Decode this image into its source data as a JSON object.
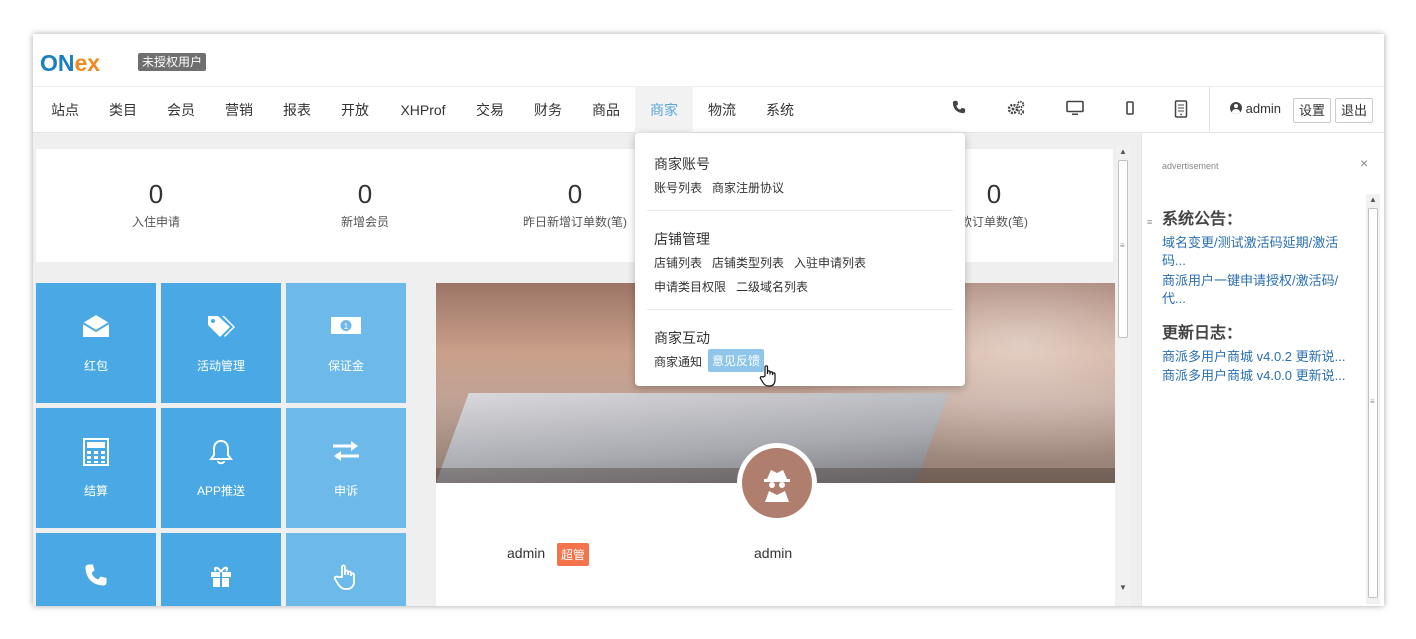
{
  "brand": {
    "logo_on": "ON",
    "logo_ex": "ex",
    "unauth_badge": "未授权用户"
  },
  "nav": {
    "items": [
      "站点",
      "类目",
      "会员",
      "营销",
      "报表",
      "开放",
      "XHProf",
      "交易",
      "财务",
      "商品",
      "商家",
      "物流",
      "系统"
    ],
    "active": "商家",
    "icons": [
      "phone-icon",
      "gears-icon",
      "desktop-icon",
      "mobile-icon",
      "tablet-icon"
    ],
    "admin_name": "admin",
    "settings_label": "设置",
    "logout_label": "退出"
  },
  "stats": [
    {
      "value": "0",
      "label": "入住申请"
    },
    {
      "value": "0",
      "label": "新增会员"
    },
    {
      "value": "0",
      "label": "昨日新增订单数(笔)"
    },
    {
      "value": "0",
      "label": "款订单数(笔)"
    }
  ],
  "tiles": [
    {
      "label": "红包",
      "icon": "envelope-icon"
    },
    {
      "label": "活动管理",
      "icon": "tags-icon"
    },
    {
      "label": "保证金",
      "icon": "money-icon"
    },
    {
      "label": "结算",
      "icon": "calculator-icon"
    },
    {
      "label": "APP推送",
      "icon": "bell-icon"
    },
    {
      "label": "申诉",
      "icon": "exchange-icon"
    },
    {
      "label": "",
      "icon": "phone-icon"
    },
    {
      "label": "",
      "icon": "gift-icon"
    },
    {
      "label": "",
      "icon": "hand-pointer-icon"
    }
  ],
  "profile": {
    "name_left": "admin",
    "super_badge": "超管",
    "name_right": "admin"
  },
  "dropdown": {
    "section1_title": "商家账号",
    "section1_links": [
      "账号列表",
      "商家注册协议"
    ],
    "section2_title": "店铺管理",
    "section2_links_row1": [
      "店铺列表",
      "店铺类型列表",
      "入驻申请列表"
    ],
    "section2_links_row2": [
      "申请类目权限",
      "二级域名列表"
    ],
    "section3_title": "商家互动",
    "section3_links": [
      "商家通知",
      "意见反馈"
    ]
  },
  "right_panel": {
    "ad_label": "advertisement",
    "close": "×",
    "notice_heading": "系统公告：",
    "notice_links": [
      "域名变更/测试激活码延期/激活码...",
      "商派用户一键申请授权/激活码/代..."
    ],
    "changelog_heading": "更新日志：",
    "changelog_links": [
      "商派多用户商城 v4.0.2 更新说...",
      "商派多用户商城 v4.0.0 更新说..."
    ]
  },
  "colors": {
    "tile_blue": "#4aa9e4",
    "tile_blue_light": "#6cb9ea",
    "active_nav": "#5aa7d8",
    "badge_orange": "#f3734a",
    "link_blue": "#2a6fb0"
  }
}
